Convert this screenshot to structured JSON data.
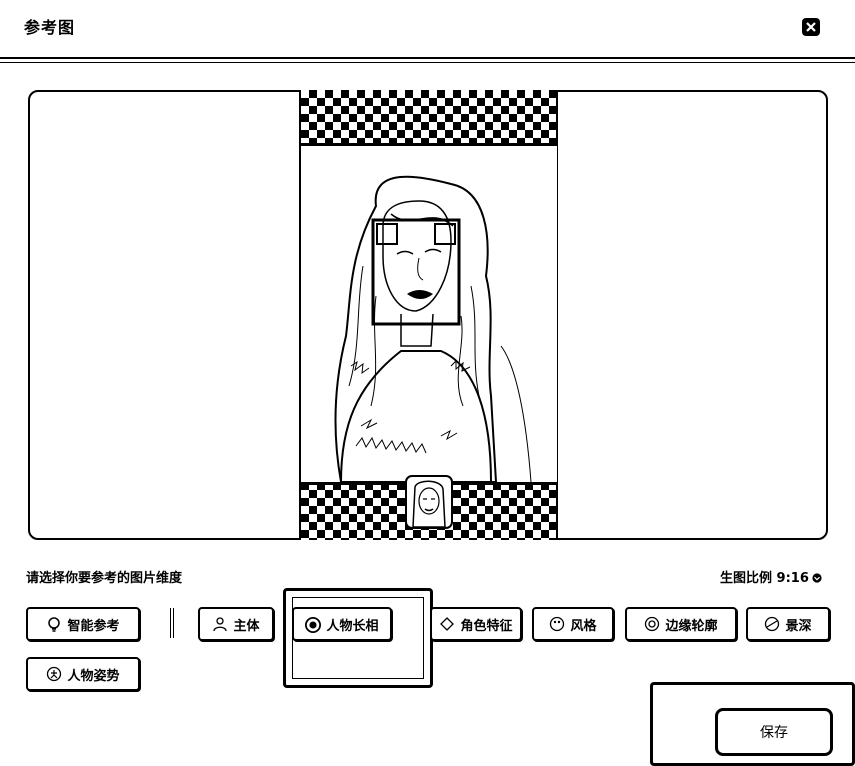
{
  "dialog": {
    "title": "参考图",
    "close_icon": "close-icon"
  },
  "preview": {
    "image_alt": "reference portrait of a woman with long wavy hair",
    "face_box_shown": true
  },
  "controls": {
    "dimension_label": "请选择你要参考的图片维度",
    "ratio_label": "生图比例 9:16",
    "ratio_icon": "chevron-down-icon"
  },
  "dimensions": [
    {
      "label": "智能参考",
      "icon": "bulb-icon",
      "selected": false
    },
    {
      "label": "主体",
      "icon": "person-icon",
      "selected": false
    },
    {
      "label": "人物长相",
      "icon": "radio-selected-icon",
      "selected": true
    },
    {
      "label": "角色特征",
      "icon": "role-icon",
      "selected": false
    },
    {
      "label": "风格",
      "icon": "palette-icon",
      "selected": false
    },
    {
      "label": "边缘轮廓",
      "icon": "outline-icon",
      "selected": false
    },
    {
      "label": "景深",
      "icon": "depth-icon",
      "selected": false
    },
    {
      "label": "人物姿势",
      "icon": "pose-icon",
      "selected": false
    }
  ],
  "footer": {
    "save_label": "保存"
  }
}
